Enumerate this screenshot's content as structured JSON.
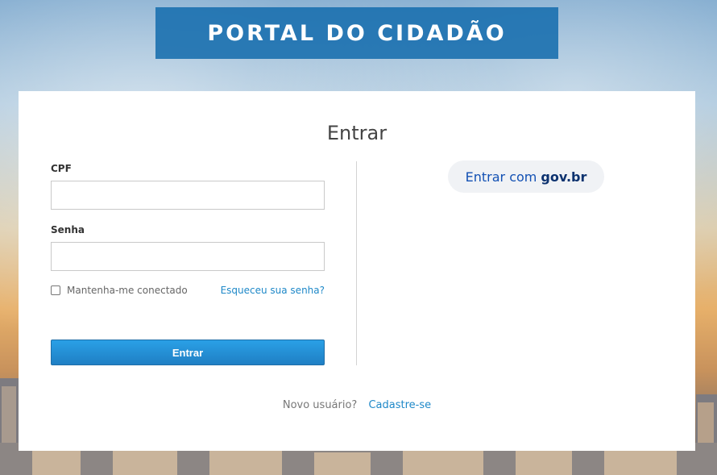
{
  "header": {
    "title": "PORTAL DO CIDADÃO"
  },
  "login": {
    "title": "Entrar",
    "cpf_label": "CPF",
    "cpf_value": "",
    "password_label": "Senha",
    "password_value": "",
    "remember_label": "Mantenha-me conectado",
    "remember_checked": false,
    "forgot_label": "Esqueceu sua senha?",
    "submit_label": "Entrar"
  },
  "govbr": {
    "prefix": "Entrar com",
    "brand": "gov.br"
  },
  "signup": {
    "prompt": "Novo usuário?",
    "link": "Cadastre-se"
  },
  "colors": {
    "accent": "#1e88c8",
    "banner": "#1b70af",
    "govbr_blue": "#1351b4"
  }
}
